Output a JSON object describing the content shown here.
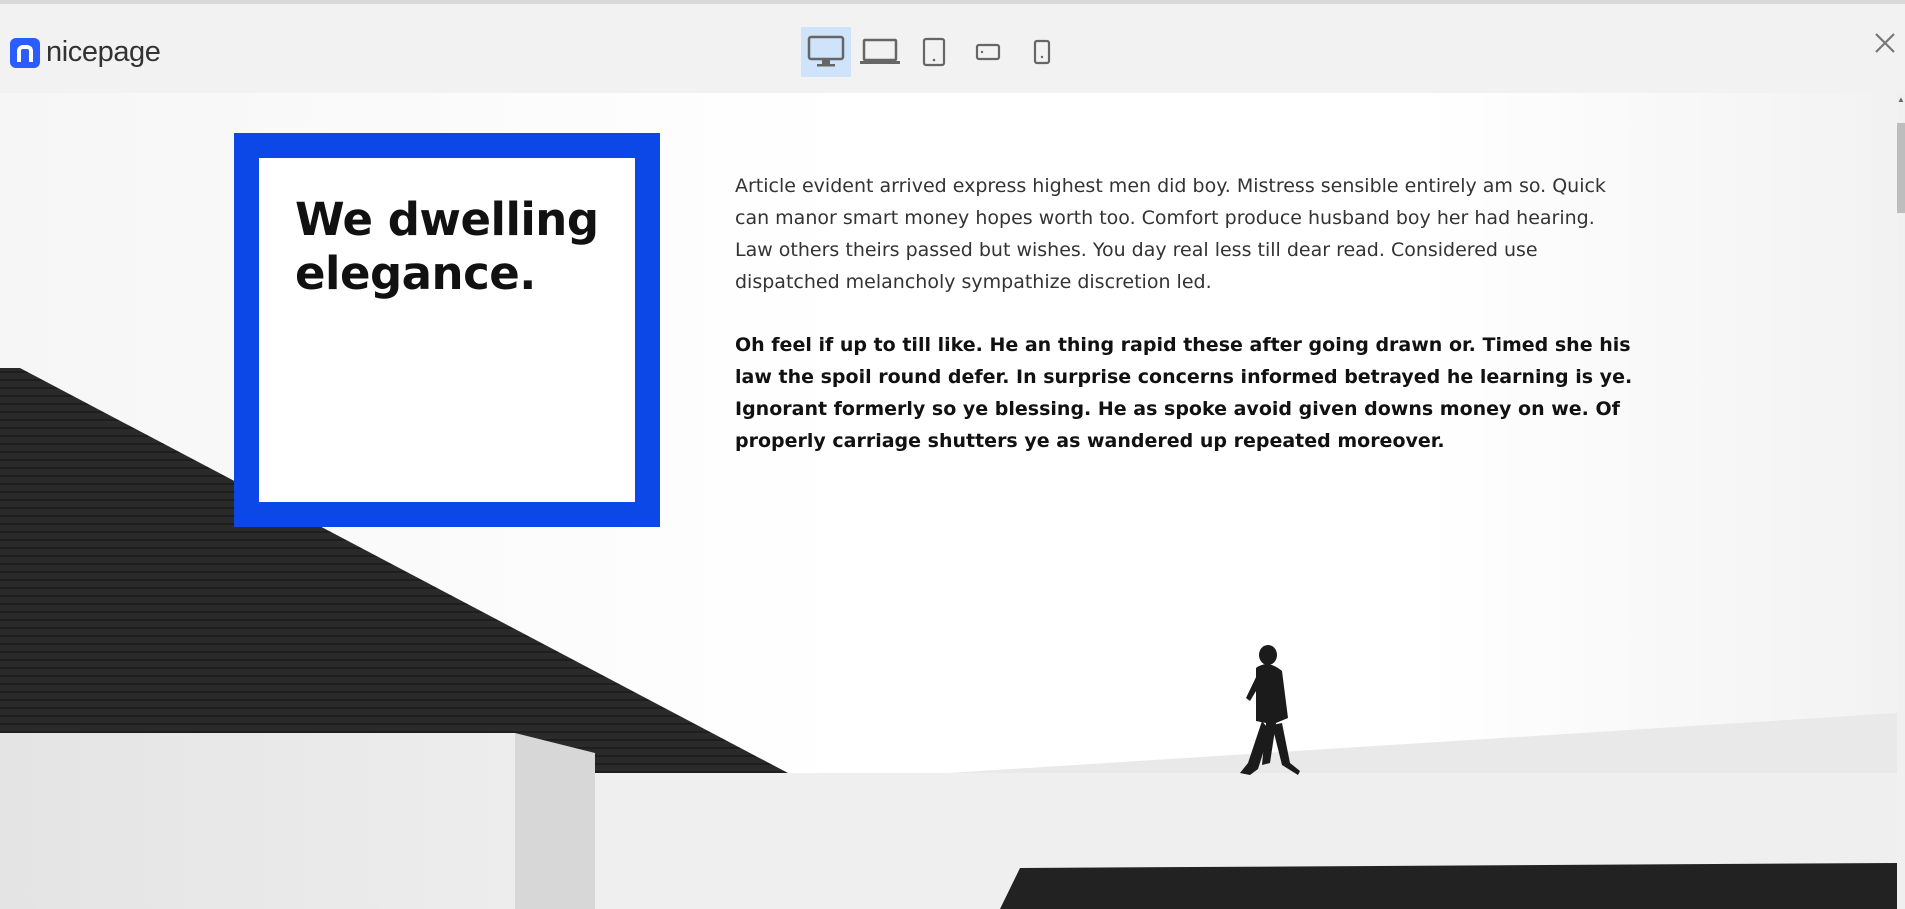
{
  "app": {
    "logo_text": "nicepage",
    "brand_color": "#2a5cff"
  },
  "toolbar": {
    "devices": [
      {
        "name": "desktop-icon",
        "active": true
      },
      {
        "name": "laptop-icon",
        "active": false
      },
      {
        "name": "tablet-icon",
        "active": false
      },
      {
        "name": "phone-landscape-icon",
        "active": false
      },
      {
        "name": "phone-portrait-icon",
        "active": false
      }
    ],
    "close_icon": "close-icon",
    "active_color": "#cfe4fa"
  },
  "section": {
    "heading": "We dwelling elegance.",
    "paragraph1": "Article evident arrived express highest men did boy. Mistress sensible entirely am so. Quick can manor smart money hopes worth too. Comfort produce husband boy her had hearing. Law others theirs passed but wishes. You day real less till dear read. Considered use dispatched melancholy sympathize discretion led.",
    "paragraph2": "Oh feel if up to till like. He an thing rapid these after going drawn or. Timed she his law the spoil round defer. In surprise concerns informed betrayed he learning is ye. Ignorant formerly so ye blessing. He as spoke avoid given downs money on we. Of properly carriage shutters ye as wandered up repeated moreover.",
    "frame_color": "#0c48e8"
  }
}
